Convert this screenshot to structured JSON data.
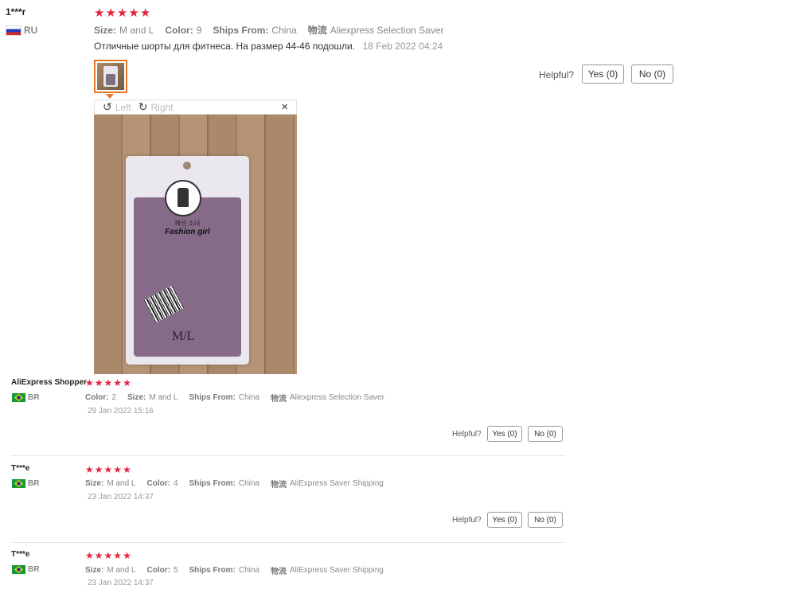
{
  "reviews": [
    {
      "user": "1***r",
      "country": "RU",
      "rating": 5,
      "attrs": [
        {
          "k": "Size:",
          "v": "M and L"
        },
        {
          "k": "Color:",
          "v": "9"
        },
        {
          "k": "Ships From:",
          "v": "China"
        },
        {
          "k": "物流",
          "v": "Aliexpress Selection Saver"
        }
      ],
      "text": "Отличные шорты для фитнеса. На размер 44-46 подошли.",
      "date": "18 Feb 2022 04:24",
      "viewer": {
        "rotate_left": "Left",
        "rotate_right": "Right",
        "close": "×",
        "package_brand_kr": "패션 소녀",
        "package_brand": "Fashion girl",
        "package_size": "M/L"
      },
      "helpful": "Helpful?",
      "yes": "Yes (0)",
      "no": "No (0)"
    },
    {
      "user": "AliExpress Shopper",
      "country": "BR",
      "rating": 5,
      "attrs": [
        {
          "k": "Color:",
          "v": "2"
        },
        {
          "k": "Size:",
          "v": "M and L"
        },
        {
          "k": "Ships From:",
          "v": "China"
        },
        {
          "k": "物流",
          "v": "Aliexpress Selection Saver"
        }
      ],
      "date": "29 Jan 2022 15:16",
      "helpful": "Helpful?",
      "yes": "Yes (0)",
      "no": "No (0)"
    },
    {
      "user": "T***e",
      "country": "BR",
      "rating": 5,
      "attrs": [
        {
          "k": "Size:",
          "v": "M and L"
        },
        {
          "k": "Color:",
          "v": "4"
        },
        {
          "k": "Ships From:",
          "v": "China"
        },
        {
          "k": "物流",
          "v": "AliExpress Saver Shipping"
        }
      ],
      "date": "23 Jan 2022 14:37",
      "helpful": "Helpful?",
      "yes": "Yes (0)",
      "no": "No (0)"
    },
    {
      "user": "T***e",
      "country": "BR",
      "rating": 5,
      "attrs": [
        {
          "k": "Size:",
          "v": "M and L"
        },
        {
          "k": "Color:",
          "v": "5"
        },
        {
          "k": "Ships From:",
          "v": "China"
        },
        {
          "k": "物流",
          "v": "AliExpress Saver Shipping"
        }
      ],
      "date": "23 Jan 2022 14:37"
    }
  ],
  "colors": {
    "star": "#e6233f",
    "thumb_border": "#e8772e"
  },
  "icons": {
    "star": "star-icon",
    "rotate_left": "rotate-left-icon",
    "rotate_right": "rotate-right-icon",
    "close": "close-icon"
  }
}
